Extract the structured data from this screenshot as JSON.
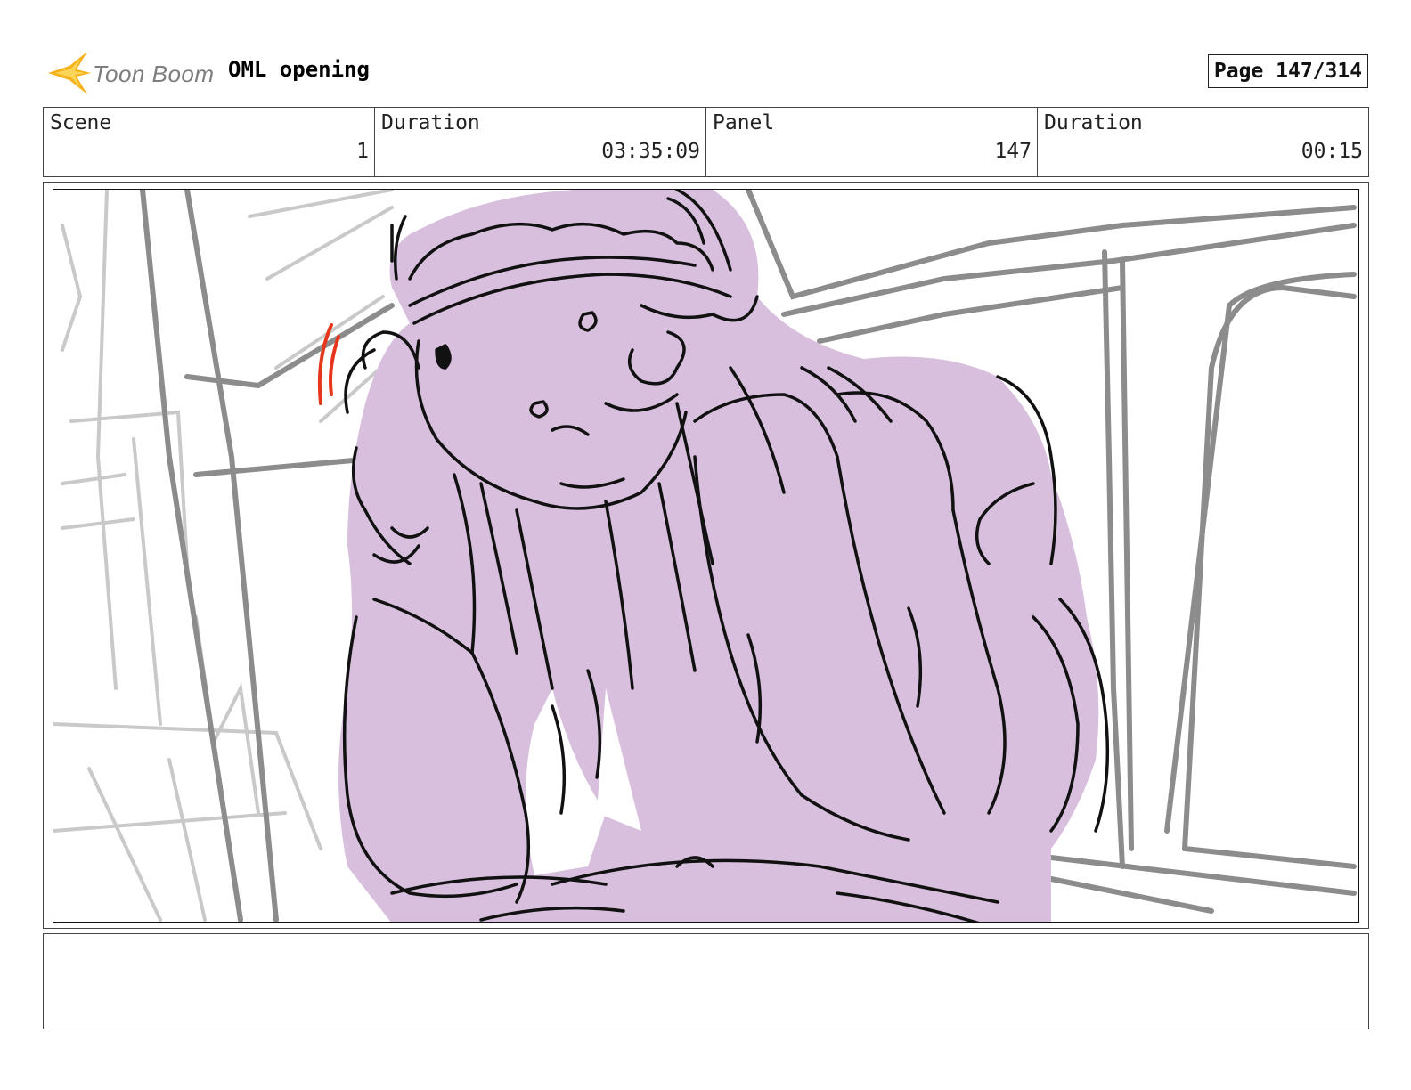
{
  "header": {
    "logo_text": "Toon Boom",
    "project_title": "OML opening",
    "page_label": "Page 147/314"
  },
  "info": [
    {
      "label": "Scene",
      "value": "1"
    },
    {
      "label": "Duration",
      "value": "03:35:09"
    },
    {
      "label": "Panel",
      "value": "147"
    },
    {
      "label": "Duration",
      "value": "00:15"
    }
  ],
  "panel": {
    "image_name": "storyboard-sketch",
    "colors": {
      "character_fill": "#d8bfde",
      "line": "#111111",
      "background_line": "#8c8c8c",
      "light_line": "#c4c4c4",
      "accent": "#e8361c"
    }
  },
  "notes": {
    "text": ""
  },
  "icons": {
    "logo": "toon-boom-star-icon"
  }
}
